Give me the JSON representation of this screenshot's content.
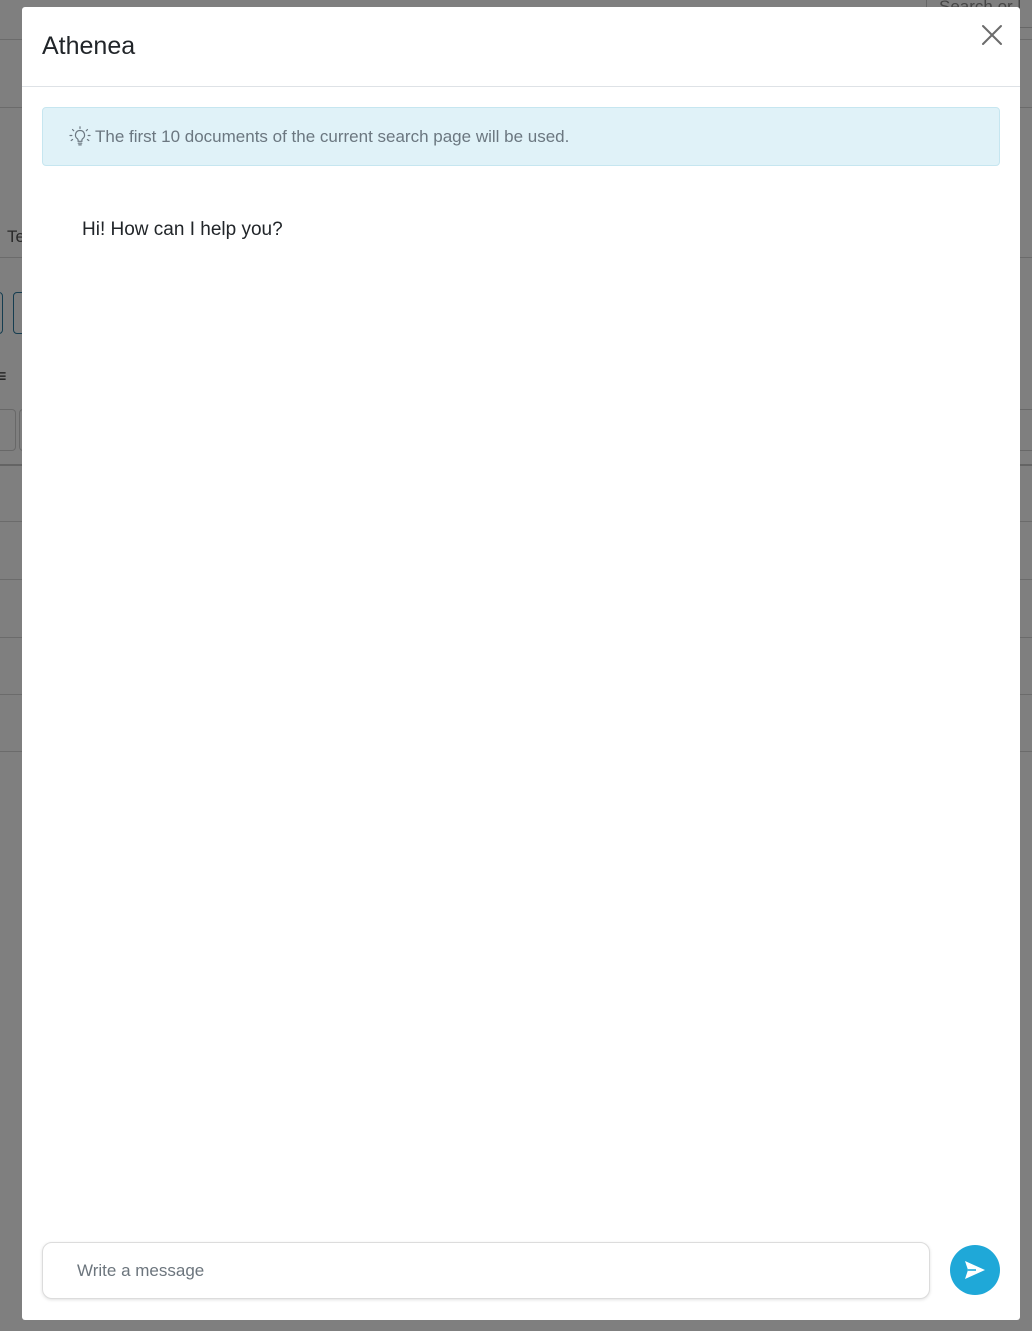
{
  "background": {
    "search_placeholder": "Search or l",
    "tab_fragment": "Te",
    "icon_glyph": "≡"
  },
  "modal": {
    "title": "Athenea",
    "close_icon": "close-icon",
    "alert": {
      "icon": "lightbulb-icon",
      "text": "The first 10 documents of the current search page will be used."
    },
    "messages": [
      {
        "text": "Hi! How can I help you?"
      }
    ],
    "composer": {
      "placeholder": "Write a message",
      "value": ""
    },
    "send_icon": "send-icon"
  },
  "colors": {
    "accent": "#1fa8d8",
    "alert_bg": "#e0f2f8",
    "alert_text": "#6b7780"
  }
}
